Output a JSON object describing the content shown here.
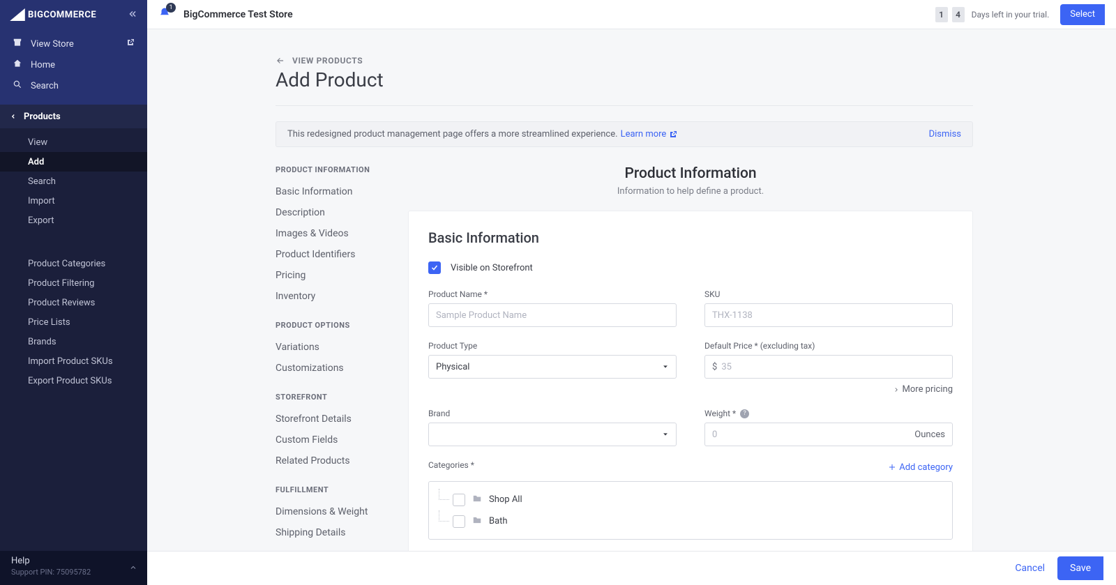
{
  "brand": "BIGCOMMERCE",
  "storeName": "BigCommerce Test Store",
  "notifications": "1",
  "trial": {
    "d1": "1",
    "d2": "4",
    "text": "Days left in your trial.",
    "cta": "Select"
  },
  "navTop": [
    {
      "icon": "store",
      "label": "View Store",
      "ext": true
    },
    {
      "icon": "home",
      "label": "Home"
    },
    {
      "icon": "search",
      "label": "Search"
    }
  ],
  "navHeader": "Products",
  "subnav": [
    "View",
    "Add",
    "Search",
    "Import",
    "Export"
  ],
  "subnavActive": "Add",
  "subnav2": [
    "Product Categories",
    "Product Filtering",
    "Product Reviews",
    "Price Lists",
    "Brands",
    "Import Product SKUs",
    "Export Product SKUs"
  ],
  "help": {
    "title": "Help",
    "pin": "Support PIN: 75095782"
  },
  "back": "VIEW PRODUCTS",
  "pageTitle": "Add Product",
  "alert": {
    "text": "This redesigned product management page offers a more streamlined experience.",
    "link": "Learn more",
    "dismiss": "Dismiss"
  },
  "sideMenu": [
    {
      "head": "PRODUCT INFORMATION",
      "items": [
        "Basic Information",
        "Description",
        "Images & Videos",
        "Product Identifiers",
        "Pricing",
        "Inventory"
      ]
    },
    {
      "head": "PRODUCT OPTIONS",
      "items": [
        "Variations",
        "Customizations"
      ]
    },
    {
      "head": "STOREFRONT",
      "items": [
        "Storefront Details",
        "Custom Fields",
        "Related Products"
      ]
    },
    {
      "head": "FULFILLMENT",
      "items": [
        "Dimensions & Weight",
        "Shipping Details"
      ]
    }
  ],
  "section": {
    "title": "Product Information",
    "sub": "Information to help define a product."
  },
  "card": {
    "title": "Basic Information",
    "visible": "Visible on Storefront",
    "productName": {
      "label": "Product Name *",
      "placeholder": "Sample Product Name"
    },
    "sku": {
      "label": "SKU",
      "placeholder": "THX-1138"
    },
    "productType": {
      "label": "Product Type",
      "value": "Physical"
    },
    "price": {
      "label": "Default Price * (excluding tax)",
      "currency": "$",
      "placeholder": "35",
      "more": "More pricing"
    },
    "brand": {
      "label": "Brand"
    },
    "weight": {
      "label": "Weight *",
      "placeholder": "0",
      "unit": "Ounces"
    },
    "categories": {
      "label": "Categories *",
      "add": "Add category",
      "items": [
        "Shop All",
        "Bath"
      ]
    }
  },
  "footer": {
    "cancel": "Cancel",
    "save": "Save"
  }
}
